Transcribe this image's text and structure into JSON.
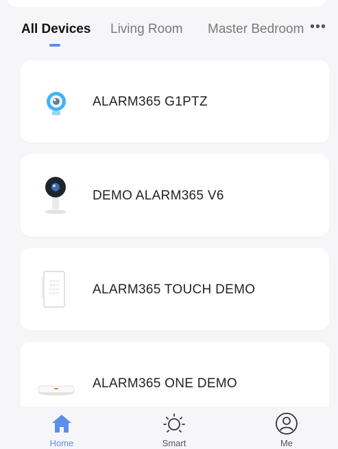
{
  "tabs": [
    {
      "label": "All Devices",
      "active": true
    },
    {
      "label": "Living Room",
      "active": false
    },
    {
      "label": "Master Bedroom",
      "active": false
    }
  ],
  "more_icon": "more-dots-icon",
  "devices": [
    {
      "name": "ALARM365 G1PTZ",
      "icon": "ptz-camera-icon"
    },
    {
      "name": "DEMO ALARM365 V6",
      "icon": "indoor-camera-icon"
    },
    {
      "name": "ALARM365 TOUCH DEMO",
      "icon": "touch-panel-icon"
    },
    {
      "name": "ALARM365 ONE DEMO",
      "icon": "hub-device-icon"
    }
  ],
  "tabbar": {
    "home": {
      "label": "Home",
      "icon": "home-icon",
      "active": true
    },
    "smart": {
      "label": "Smart",
      "icon": "sun-icon",
      "active": false
    },
    "me": {
      "label": "Me",
      "icon": "user-circle-icon",
      "active": false
    }
  },
  "colors": {
    "accent": "#5b8def",
    "background": "#f6f6f8",
    "card": "#ffffff"
  }
}
